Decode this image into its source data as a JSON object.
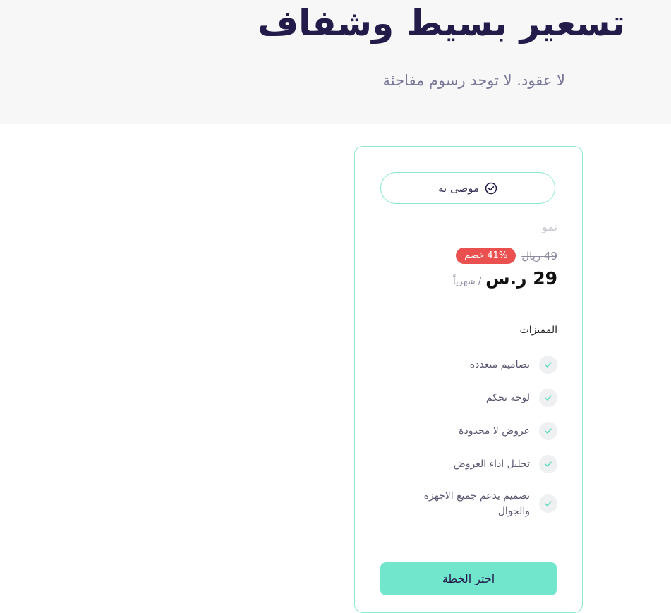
{
  "hero": {
    "title": "تسعير بسيط وشفاف",
    "subtitle": "لا عقود. لا توجد رسوم مفاجئة"
  },
  "plan": {
    "badge_label": "موصى به",
    "badge_icon": "check-circle-icon",
    "name": "نمو",
    "old_price": "49 ريال",
    "discount": "41% خصم",
    "price": "29 ر.س",
    "period": "/ شهرياً",
    "features_title": "المميزات",
    "features": [
      {
        "label": "تصاميم متعددة"
      },
      {
        "label": "لوحة تحكم"
      },
      {
        "label": "عروض لا محدودة"
      },
      {
        "label": "تحليل اداء العروض"
      },
      {
        "label": "تصميم يدعم جميع الاجهزة والجوال"
      }
    ],
    "cta_label": "اختر الخطة"
  },
  "colors": {
    "accent": "#72e6cd",
    "border": "#8ee8cf",
    "title": "#231c4a",
    "discount": "#e9504f"
  }
}
